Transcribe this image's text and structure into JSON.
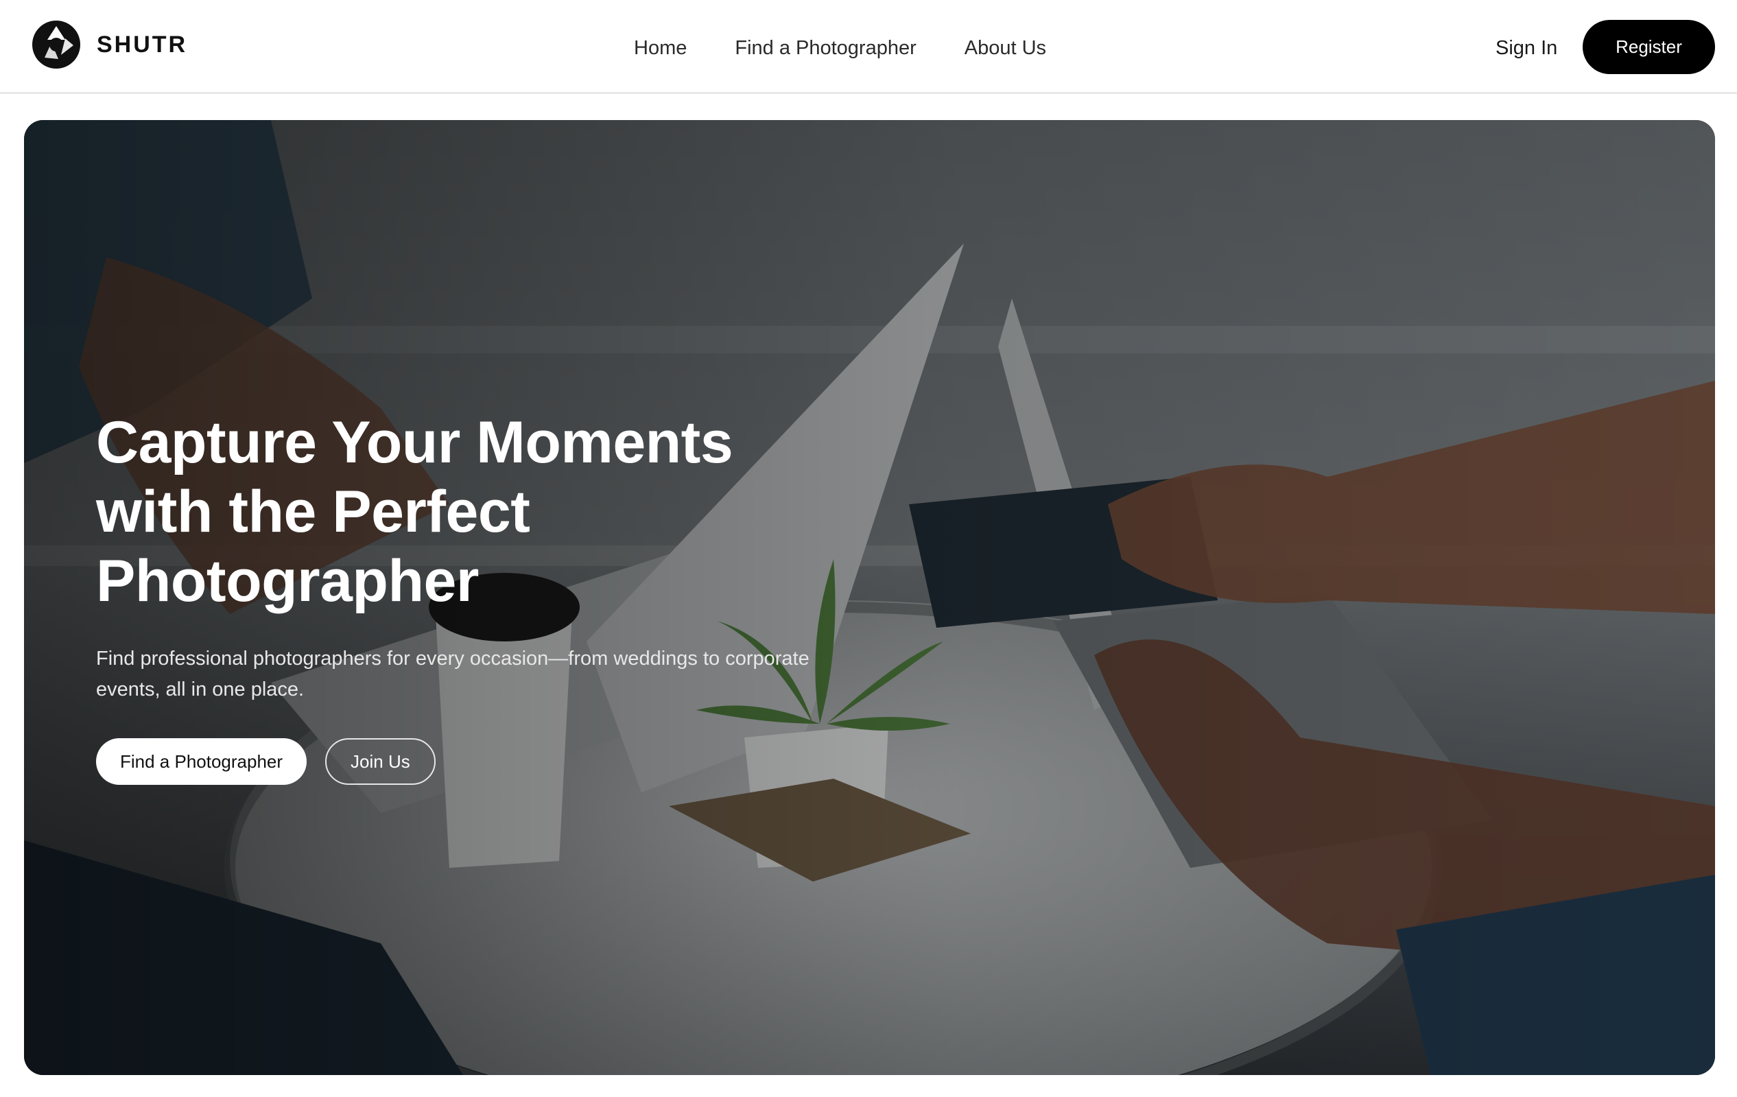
{
  "header": {
    "brand_name": "SHUTR",
    "logo_icon": "camera-aperture-logo",
    "nav": [
      {
        "label": "Home"
      },
      {
        "label": "Find a Photographer"
      },
      {
        "label": "About Us"
      }
    ],
    "sign_in_label": "Sign In",
    "register_label": "Register"
  },
  "hero": {
    "title_lines": [
      "Capture Your Moments",
      "with the Perfect",
      "Photographer"
    ],
    "subtitle": "Find professional photographers for every occasion—from weddings to corporate events, all in one place.",
    "primary_cta": "Find a Photographer",
    "secondary_cta": "Join Us",
    "background_image": "people-working-laptops-cafe-table-photo"
  },
  "colors": {
    "primary": "#000000",
    "background": "#ffffff",
    "hero_text": "#ffffff",
    "border": "#e8e8e8"
  }
}
